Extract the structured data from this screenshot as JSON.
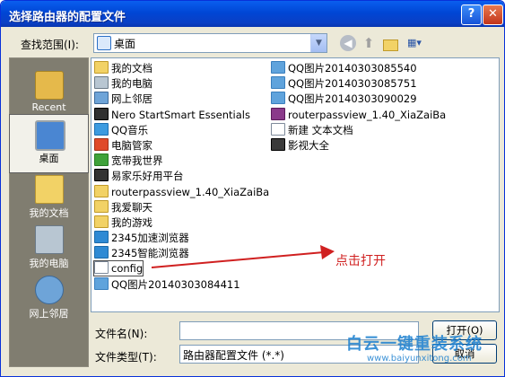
{
  "window": {
    "title": "选择路由器的配置文件",
    "help_label": "?",
    "close_label": "✕"
  },
  "toolbar": {
    "look_in_label": "查找范围(I):",
    "look_in_value": "桌面",
    "icons": [
      "back-icon",
      "up-folder-icon",
      "new-folder-icon",
      "views-menu-icon"
    ]
  },
  "places": [
    {
      "label": "Recent",
      "icon": "recent-icon"
    },
    {
      "label": "桌面",
      "icon": "desktop-icon"
    },
    {
      "label": "我的文档",
      "icon": "my-documents-icon"
    },
    {
      "label": "我的电脑",
      "icon": "my-computer-icon"
    },
    {
      "label": "网上邻居",
      "icon": "network-icon"
    }
  ],
  "files": {
    "col1": [
      {
        "name": "我的文档",
        "icon": "mydocs"
      },
      {
        "name": "我的电脑",
        "icon": "pc"
      },
      {
        "name": "网上邻居",
        "icon": "net"
      },
      {
        "name": "Nero StartSmart Essentials",
        "icon": "nero"
      },
      {
        "name": "QQ音乐",
        "icon": "qq"
      },
      {
        "name": "电脑管家",
        "icon": "mgr"
      },
      {
        "name": "宽带我世界",
        "icon": "world"
      },
      {
        "name": "易家乐好用平台",
        "icon": "ejiale"
      },
      {
        "name": "routerpassview_1.40_XiaZaiBa",
        "icon": "folder"
      },
      {
        "name": "我爱聊天",
        "icon": "folder"
      },
      {
        "name": "我的游戏",
        "icon": "folder"
      },
      {
        "name": "2345加速浏览器",
        "icon": "browser"
      },
      {
        "name": "2345智能浏览器",
        "icon": "browser"
      },
      {
        "name": "config",
        "icon": "file"
      },
      {
        "name": "QQ图片20140303084411",
        "icon": "img"
      }
    ],
    "col2": [
      {
        "name": "QQ图片20140303085540",
        "icon": "img"
      },
      {
        "name": "QQ图片20140303085751",
        "icon": "img"
      },
      {
        "name": "QQ图片20140303090029",
        "icon": "img"
      },
      {
        "name": "routerpassview_1.40_XiaZaiBa",
        "icon": "zip"
      },
      {
        "name": "新建 文本文档",
        "icon": "txt"
      },
      {
        "name": "影视大全",
        "icon": "video"
      }
    ]
  },
  "annotation": "点击打开",
  "filename": {
    "label": "文件名(N):",
    "value": ""
  },
  "filetype": {
    "label": "文件类型(T):",
    "value": "路由器配置文件 (*.*)"
  },
  "buttons": {
    "open": "打开(O)",
    "cancel": "取消"
  },
  "watermark": {
    "text": "白云一键重装系统",
    "url": "www.baiyunxitong.com"
  },
  "colors": {
    "title_bar": "#0054e3",
    "annotation": "#d02020",
    "places_bar": "#807d70"
  }
}
